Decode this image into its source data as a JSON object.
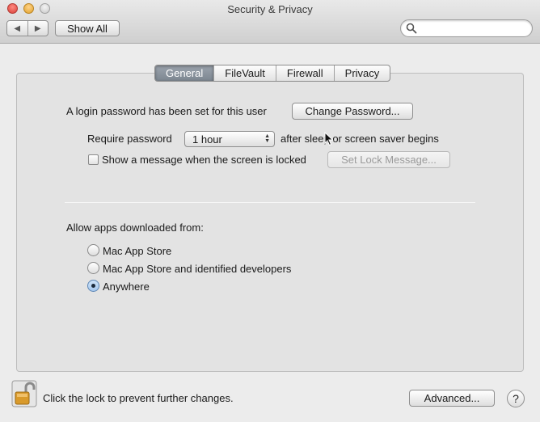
{
  "window": {
    "title": "Security & Privacy"
  },
  "toolbar": {
    "back_icon": "chevron-left-icon",
    "forward_icon": "chevron-right-icon",
    "show_all_label": "Show All",
    "search_placeholder": "",
    "search_value": "",
    "search_icon": "search-icon"
  },
  "tabs": [
    {
      "label": "General",
      "active": true
    },
    {
      "label": "FileVault",
      "active": false
    },
    {
      "label": "Firewall",
      "active": false
    },
    {
      "label": "Privacy",
      "active": false
    }
  ],
  "general": {
    "login_password_text": "A login password has been set for this user",
    "change_password_label": "Change Password...",
    "require_password_label": "Require password",
    "require_password_value": "1 hour",
    "after_sleep_text": "after sleep or screen saver begins",
    "show_message_label": "Show a message when the screen is locked",
    "show_message_checked": false,
    "set_lock_message_label": "Set Lock Message...",
    "allow_apps_label": "Allow apps downloaded from:",
    "allow_options": [
      {
        "label": "Mac App Store",
        "selected": false
      },
      {
        "label": "Mac App Store and identified developers",
        "selected": false
      },
      {
        "label": "Anywhere",
        "selected": true
      }
    ]
  },
  "footer": {
    "lock_text": "Click the lock to prevent further changes.",
    "lock_icon": "unlocked-padlock-icon",
    "advanced_label": "Advanced...",
    "help_label": "?"
  },
  "colors": {
    "window_bg": "#ececec",
    "panel_bg": "#e3e3e3",
    "active_tab": "#8b939c",
    "radio_selected": "#a6c8ee"
  }
}
